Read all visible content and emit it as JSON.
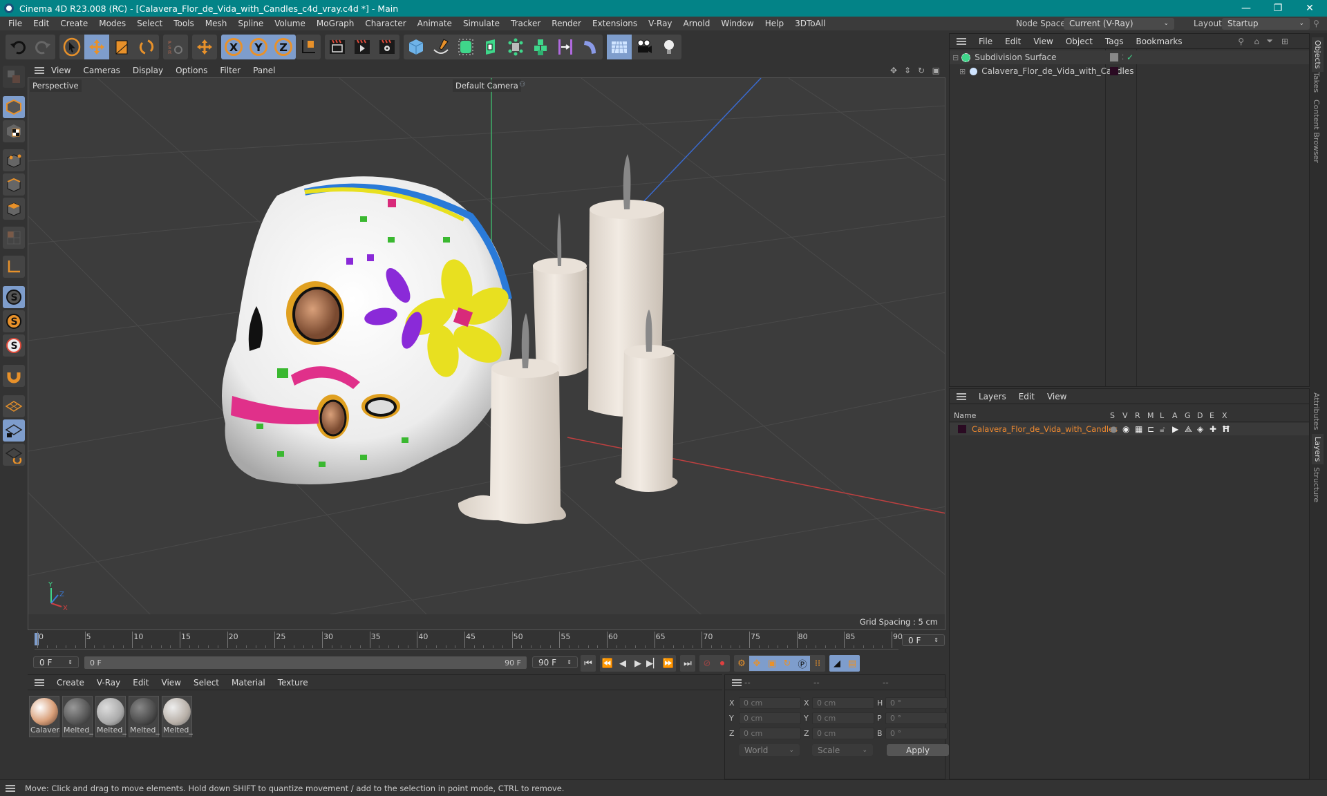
{
  "window": {
    "title": "Cinema 4D R23.008 (RC) - [Calavera_Flor_de_Vida_with_Candles_c4d_vray.c4d *] - Main",
    "controls": {
      "minimize": "—",
      "restore": "❐",
      "close": "✕"
    }
  },
  "menubar": {
    "items": [
      "File",
      "Edit",
      "Create",
      "Modes",
      "Select",
      "Tools",
      "Mesh",
      "Spline",
      "Volume",
      "MoGraph",
      "Character",
      "Animate",
      "Simulate",
      "Tracker",
      "Render",
      "Extensions",
      "V-Ray",
      "Arnold",
      "Window",
      "Help",
      "3DToAll"
    ],
    "node_space_label": "Node Space:",
    "node_space_value": "Current (V-Ray)",
    "layout_label": "Layout:",
    "layout_value": "Startup"
  },
  "toolbar": {
    "undo": "undo-icon",
    "redo": "redo-icon",
    "tools": [
      "select-live-icon",
      "move-icon",
      "scale-icon",
      "rotate-icon",
      "psr-icon",
      "recent-tool-icon"
    ],
    "axes": [
      "X",
      "Y",
      "Z"
    ],
    "coord_system": "world-coordinate-icon",
    "render": [
      "render-view-icon",
      "render-picture-viewer-icon",
      "render-settings-icon"
    ],
    "objects": [
      "cube-icon",
      "pen-icon",
      "subdivision-surface-icon",
      "extrude-icon",
      "mograph-cloner-icon",
      "voronoi-icon",
      "deformer-icon",
      "spline-deformer-icon",
      "floor-icon",
      "camera-icon",
      "light-icon"
    ]
  },
  "left_tools": [
    "make-editable",
    "model-mode",
    "texture-mode",
    "points-mode",
    "edges-mode",
    "polygons-mode",
    "uv-mode",
    "axis-mode",
    "snap-off",
    "snap-on",
    "snap-settings",
    "magnet",
    "workplane",
    "locked-workplane",
    "workplane-align"
  ],
  "viewport": {
    "menu": [
      "View",
      "Cameras",
      "Display",
      "Options",
      "Filter",
      "Panel"
    ],
    "view_name": "Perspective",
    "camera": "Default Camera",
    "grid_spacing": "Grid Spacing : 5 cm",
    "axis_labels": {
      "x": "X",
      "y": "Y",
      "z": "Z"
    }
  },
  "timeline": {
    "ticks": [
      "0",
      "5",
      "10",
      "15",
      "20",
      "25",
      "30",
      "35",
      "40",
      "45",
      "50",
      "55",
      "60",
      "65",
      "70",
      "75",
      "80",
      "85",
      "90"
    ],
    "current_frame": "0 F",
    "start_field": "0 F",
    "range_start": "0 F",
    "range_end": "90 F",
    "end_field": "90 F",
    "frame_right": "0 F"
  },
  "materials": {
    "menu": [
      "Create",
      "V-Ray",
      "Edit",
      "View",
      "Select",
      "Material",
      "Texture"
    ],
    "items": [
      {
        "label": "Calavera"
      },
      {
        "label": "Melted_("
      },
      {
        "label": "Melted_("
      },
      {
        "label": "Melted_("
      },
      {
        "label": "Melted_("
      }
    ]
  },
  "coords": {
    "headers": [
      "--",
      "--",
      "--"
    ],
    "rows": [
      {
        "l1": "X",
        "v1": "0 cm",
        "l2": "X",
        "v2": "0 cm",
        "l3": "H",
        "v3": "0 °"
      },
      {
        "l1": "Y",
        "v1": "0 cm",
        "l2": "Y",
        "v2": "0 cm",
        "l3": "P",
        "v3": "0 °"
      },
      {
        "l1": "Z",
        "v1": "0 cm",
        "l2": "Z",
        "v2": "0 cm",
        "l3": "B",
        "v3": "0 °"
      }
    ],
    "space": "World",
    "mode": "Scale",
    "apply": "Apply"
  },
  "objects_panel": {
    "menu": [
      "File",
      "Edit",
      "View",
      "Object",
      "Tags",
      "Bookmarks"
    ],
    "items": [
      {
        "name": "Subdivision Surface",
        "icon": "subdivision-surface-icon"
      },
      {
        "name": "Calavera_Flor_de_Vida_with_Candles",
        "icon": "null-object-icon",
        "color": "#2a0a22"
      }
    ]
  },
  "layers_panel": {
    "menu": [
      "Layers",
      "Edit",
      "View"
    ],
    "columns": [
      "Name",
      "S",
      "V",
      "R",
      "M",
      "L",
      "A",
      "G",
      "D",
      "E",
      "X"
    ],
    "items": [
      {
        "name": "Calavera_Flor_de_Vida_with_Candles",
        "color": "#2a0a22",
        "text_color": "#f08a30"
      }
    ]
  },
  "right_tabs": {
    "top": [
      "Objects",
      "Takes",
      "Content Browser"
    ],
    "bottom": [
      "Attributes",
      "Layers",
      "Structure"
    ]
  },
  "statusbar": {
    "text": "Move: Click and drag to move elements. Hold down SHIFT to quantize movement / add to the selection in point mode, CTRL to remove."
  },
  "colors": {
    "titlebar": "#038387",
    "accent_selected": "#7e9dcc",
    "tool_orange": "#e8912a",
    "layer_name": "#f08a30"
  }
}
